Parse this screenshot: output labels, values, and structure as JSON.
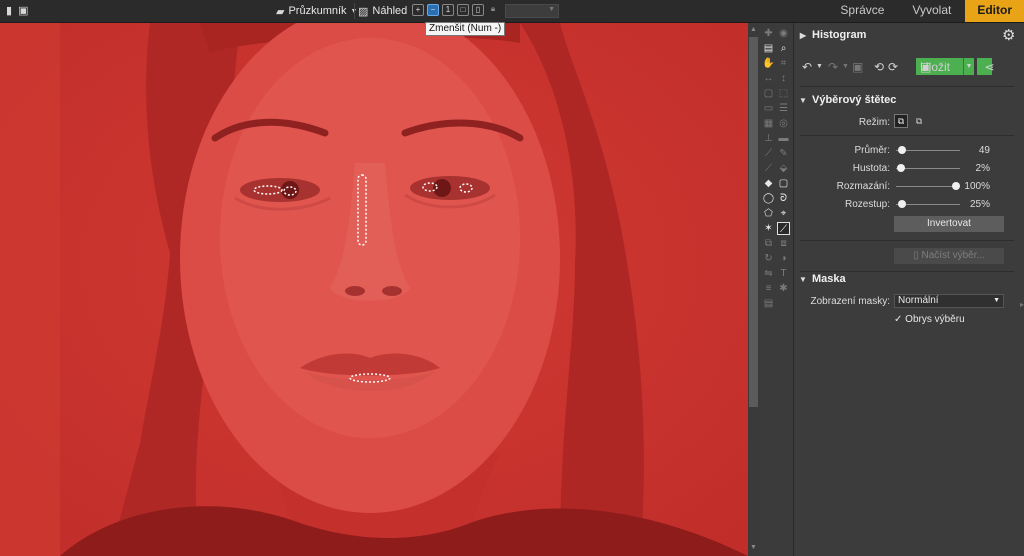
{
  "toolbar": {
    "explorer_label": "Průzkumník",
    "preview_label": "Náhled",
    "zoom_value": "",
    "tooltip": "Zmenšit (Num -)"
  },
  "modes": [
    {
      "label": "Správce",
      "active": false
    },
    {
      "label": "Vyvolat",
      "active": false
    },
    {
      "label": "Editor",
      "active": true
    }
  ],
  "panel": {
    "histogram_title": "Histogram",
    "save_label": "Uložit",
    "brush": {
      "title": "Výběrový štětec",
      "mode_label": "Režim:",
      "diameter_label": "Průměr:",
      "diameter_value": "49",
      "density_label": "Hustota:",
      "density_value": "2%",
      "blur_label": "Rozmazání:",
      "blur_value": "100%",
      "spacing_label": "Rozestup:",
      "spacing_value": "25%",
      "invert_label": "Invertovat",
      "load_label": "Načíst výběr..."
    },
    "mask": {
      "title": "Maska",
      "display_label": "Zobrazení masky:",
      "display_value": "Normální",
      "outline_label": "Obrys výběru",
      "outline_checked": true
    }
  },
  "slider_levels": {
    "diameter": 0.03,
    "density": 0.02,
    "blur": 1.0,
    "spacing": 0.03
  },
  "colors": {
    "accent": "#e8a317",
    "save": "#4caf50",
    "mask": "#c9302c"
  }
}
